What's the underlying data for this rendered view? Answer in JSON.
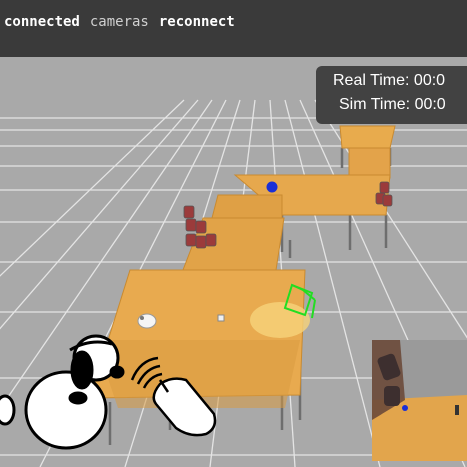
{
  "toolbar": {
    "connected_label": "connected",
    "cameras_label": "cameras",
    "reconnect_label": "reconnect"
  },
  "time_panel": {
    "real_time_label": "Real Time: 00:0",
    "sim_time_label": "Sim Time: 00:0"
  },
  "colors": {
    "toolbar_bg": "#3a3a3a",
    "floor": "#a9a9a9",
    "grid_lines": "#f0f0f0",
    "table_top": "#e4a64a",
    "marker": "#22dd22",
    "ball": "#1a2fd6",
    "can": "#9a3a3a"
  },
  "icons": [
    "dog-icon",
    "hand-wave-icon",
    "camera-view-thumbnail"
  ]
}
